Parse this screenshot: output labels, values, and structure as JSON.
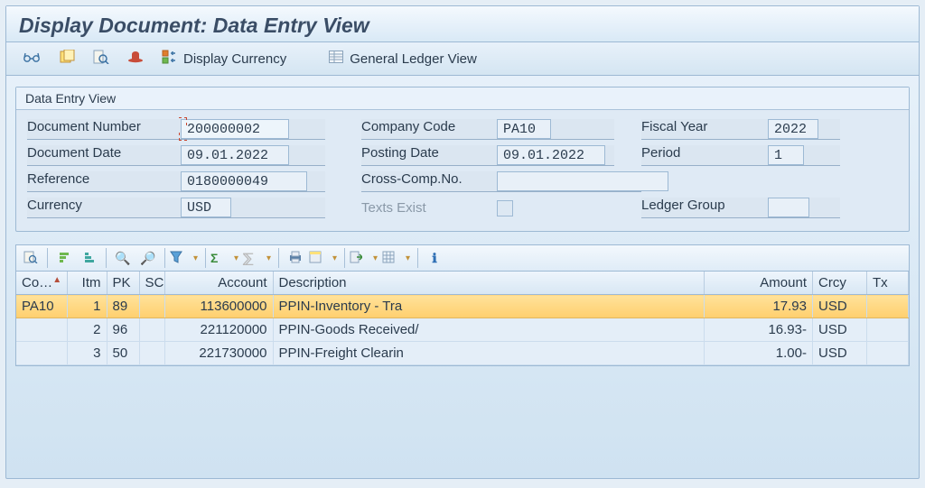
{
  "title": "Display Document: Data Entry View",
  "toolbar": {
    "display_currency": "Display Currency",
    "gl_view": "General Ledger View"
  },
  "group": {
    "title": "Data Entry View",
    "labels": {
      "doc_number": "Document Number",
      "company_code": "Company Code",
      "fiscal_year": "Fiscal Year",
      "doc_date": "Document Date",
      "posting_date": "Posting Date",
      "period": "Period",
      "reference": "Reference",
      "cross_comp": "Cross-Comp.No.",
      "currency": "Currency",
      "texts_exist": "Texts Exist",
      "ledger_group": "Ledger Group"
    },
    "values": {
      "doc_number": "200000002",
      "company_code": "PA10",
      "fiscal_year": "2022",
      "doc_date": "09.01.2022",
      "posting_date": "09.01.2022",
      "period": "1",
      "reference": "0180000049",
      "cross_comp": "",
      "currency": "USD",
      "ledger_group": ""
    }
  },
  "grid": {
    "columns": {
      "co": "Co…",
      "itm": "Itm",
      "pk": "PK",
      "sc": "SC",
      "account": "Account",
      "description": "Description",
      "amount": "Amount",
      "crcy": "Crcy",
      "tx": "Tx"
    },
    "rows": [
      {
        "co": "PA10",
        "itm": "1",
        "pk": "89",
        "sc": "",
        "account": "113600000",
        "description": "PPIN-Inventory - Tra",
        "amount": "17.93",
        "crcy": "USD",
        "tx": ""
      },
      {
        "co": "",
        "itm": "2",
        "pk": "96",
        "sc": "",
        "account": "221120000",
        "description": "PPIN-Goods Received/",
        "amount": "16.93-",
        "crcy": "USD",
        "tx": ""
      },
      {
        "co": "",
        "itm": "3",
        "pk": "50",
        "sc": "",
        "account": "221730000",
        "description": "PPIN-Freight Clearin",
        "amount": "1.00-",
        "crcy": "USD",
        "tx": ""
      }
    ]
  }
}
